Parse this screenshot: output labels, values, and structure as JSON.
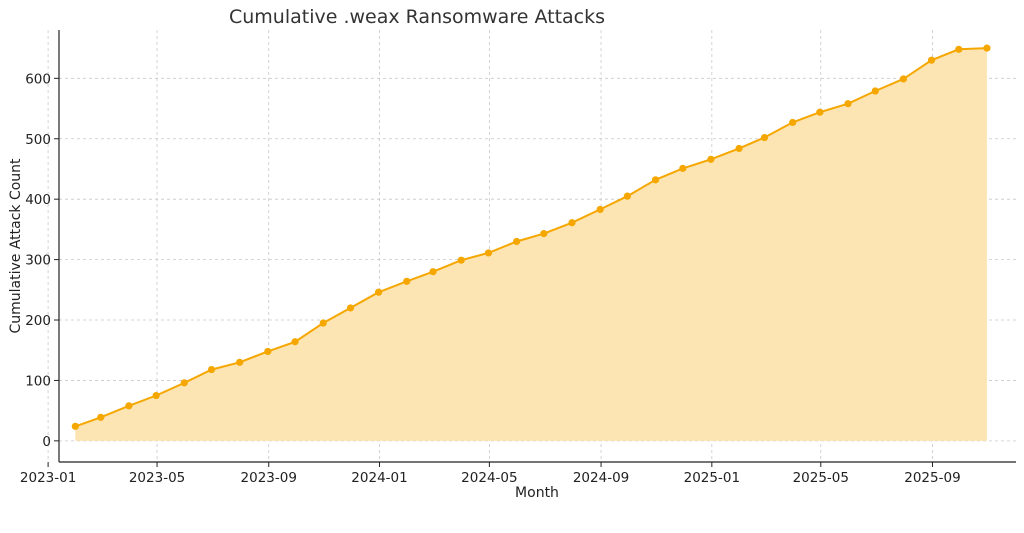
{
  "chart_data": {
    "type": "area",
    "title": "Cumulative .weax Ransomware Attacks",
    "xlabel": "Month",
    "ylabel": "Cumulative Attack Count",
    "x_ticks": [
      "2023-01",
      "2023-05",
      "2023-09",
      "2024-01",
      "2024-05",
      "2024-09",
      "2025-01",
      "2025-05",
      "2025-09"
    ],
    "y_ticks": [
      0,
      100,
      200,
      300,
      400,
      500,
      600
    ],
    "ylim": [
      -35,
      680
    ],
    "xlim": [
      "2023-01-13",
      "2025-12-02"
    ],
    "grid": true,
    "color": "#f5a700",
    "fill_color": "#fde5b3",
    "series": [
      {
        "x": [
          "2023-01-31",
          "2023-02-28",
          "2023-03-31",
          "2023-04-30",
          "2023-05-31",
          "2023-06-30",
          "2023-07-31",
          "2023-08-31",
          "2023-09-30",
          "2023-10-31",
          "2023-11-30",
          "2023-12-31",
          "2024-01-31",
          "2024-02-29",
          "2024-03-31",
          "2024-04-30",
          "2024-05-31",
          "2024-06-30",
          "2024-07-31",
          "2024-08-31",
          "2024-09-30",
          "2024-10-31",
          "2024-11-30",
          "2024-12-31",
          "2025-01-31",
          "2025-02-28",
          "2025-03-31",
          "2025-04-30",
          "2025-05-31",
          "2025-06-30",
          "2025-07-31",
          "2025-08-31",
          "2025-09-30",
          "2025-10-31"
        ],
        "values": [
          24,
          39,
          58,
          75,
          96,
          118,
          130,
          148,
          164,
          195,
          220,
          246,
          264,
          280,
          299,
          311,
          330,
          343,
          361,
          383,
          405,
          432,
          451,
          466,
          484,
          502,
          527,
          544,
          558,
          579,
          599,
          630,
          648,
          650
        ]
      }
    ]
  }
}
